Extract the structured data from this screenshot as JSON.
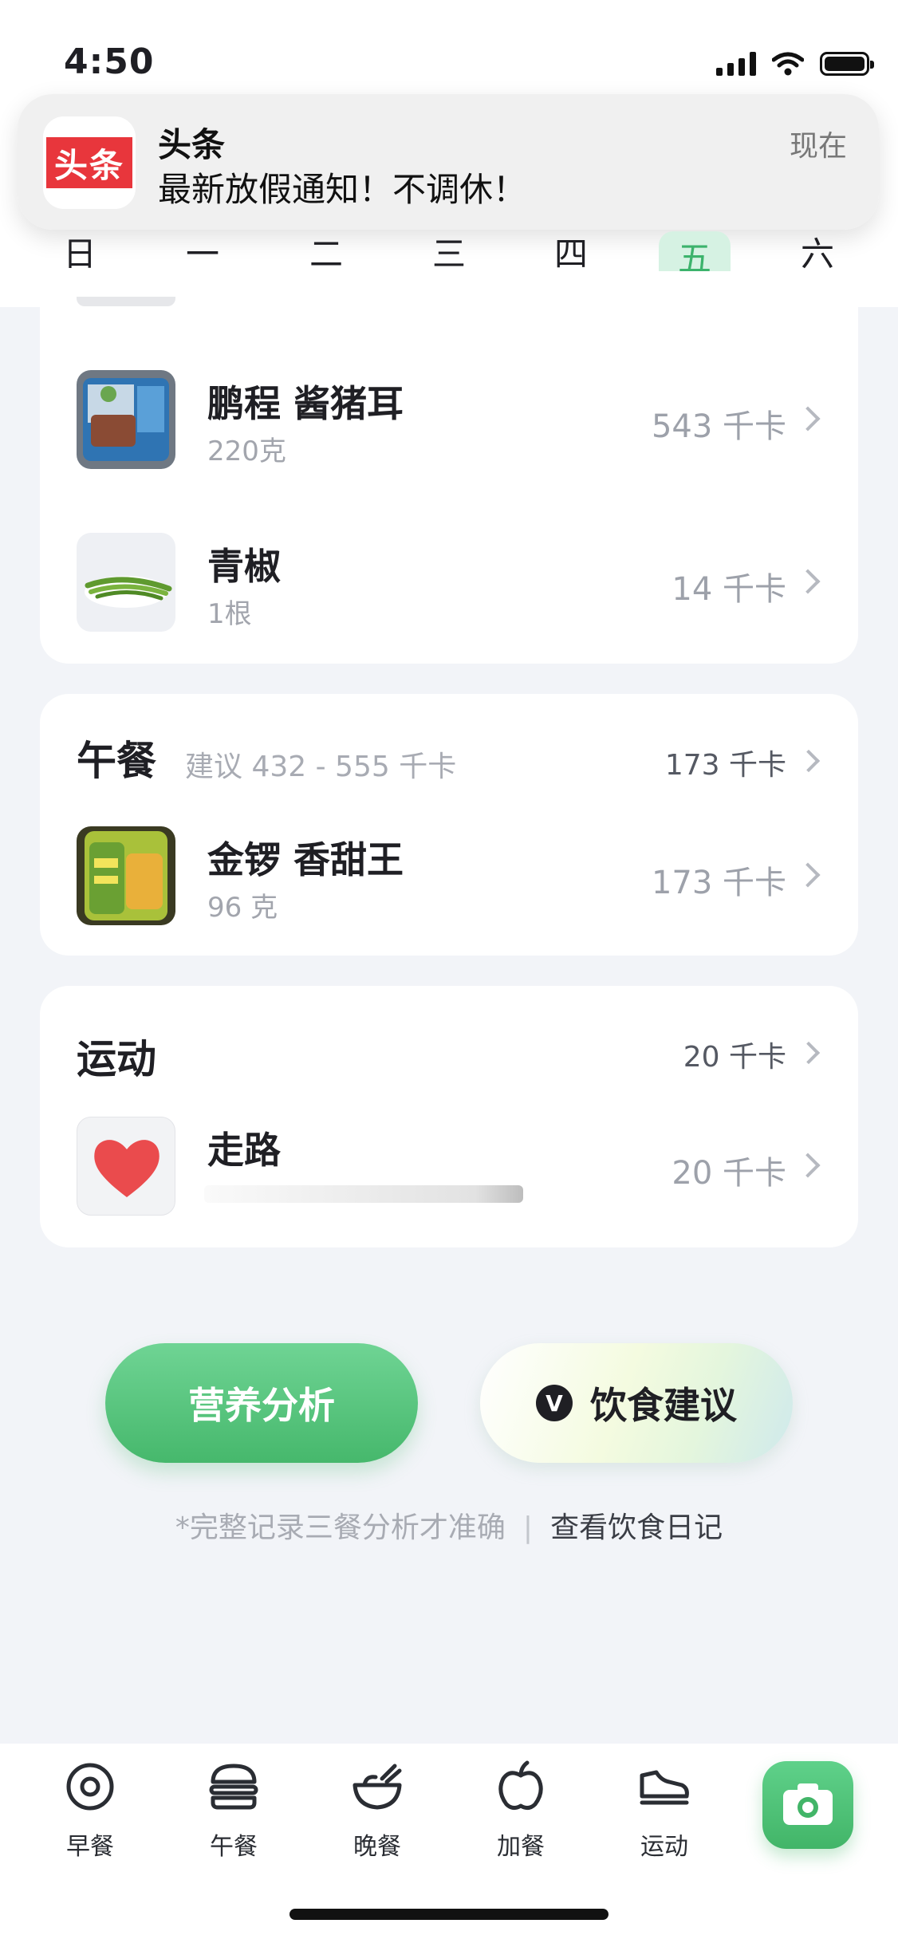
{
  "status_bar": {
    "time": "4:50"
  },
  "notification": {
    "app_logo_text": "头条",
    "app_name": "头条",
    "message": "最新放假通知！不调休！",
    "time": "现在"
  },
  "week": {
    "days": [
      "日",
      "一",
      "二",
      "三",
      "四",
      "五",
      "六"
    ],
    "selected": "五"
  },
  "breakfast_items": [
    {
      "name": "鹏程 酱猪耳",
      "amount": "220克",
      "kcal": "543 千卡"
    },
    {
      "name": "青椒",
      "amount": "1根",
      "kcal": "14 千卡"
    }
  ],
  "lunch": {
    "title": "午餐",
    "hint": "建议 432 - 555 千卡",
    "total_kcal": "173 千卡",
    "items": [
      {
        "name": "金锣 香甜王",
        "amount": "96 克",
        "kcal": "173 千卡"
      }
    ]
  },
  "exercise": {
    "title": "运动",
    "total_kcal": "20 千卡",
    "items": [
      {
        "name": "走路",
        "kcal": "20 千卡"
      }
    ]
  },
  "actions": {
    "analysis_label": "营养分析",
    "advice_logo": "V",
    "advice_label": "饮食建议"
  },
  "footer": {
    "note": "*完整记录三餐分析才准确",
    "separator": "|",
    "diary_link": "查看饮食日记"
  },
  "tabbar": {
    "tabs": [
      {
        "label": "早餐",
        "icon": "donut-icon"
      },
      {
        "label": "午餐",
        "icon": "burger-icon"
      },
      {
        "label": "晚餐",
        "icon": "bowl-icon"
      },
      {
        "label": "加餐",
        "icon": "apple-icon"
      },
      {
        "label": "运动",
        "icon": "sneaker-icon"
      }
    ],
    "camera_icon": "camera-icon"
  },
  "colors": {
    "accent_green": "#4cbf72",
    "selected_day_bg": "#d6f2e3",
    "notification_brand": "#e8363c",
    "heart": "#ea4b4d"
  }
}
